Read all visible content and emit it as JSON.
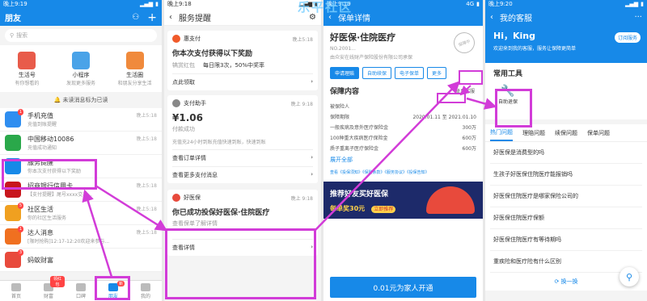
{
  "watermark": "乐平社区",
  "p1": {
    "status": {
      "time": "晚上9:19"
    },
    "title": "朋友",
    "search_placeholder": "搜索",
    "tiles": [
      {
        "name": "生活号",
        "sub": "有你想看的",
        "color": "#e85b4a"
      },
      {
        "name": "小程序",
        "sub": "发现更多服务",
        "color": "#4aa3e8"
      },
      {
        "name": "生活圈",
        "sub": "和朋友分享生活",
        "color": "#f08a3c"
      }
    ],
    "unread_bar": "未读消息标为已读",
    "messages": [
      {
        "title": "手机充值",
        "sub": "充值到账提醒",
        "time": "晚上5:18",
        "color": "#2f8ef0",
        "badge": "1"
      },
      {
        "title": "中国移动10086",
        "sub": "充值成功通知",
        "time": "晚上5:18",
        "color": "#2aa84a",
        "badge": ""
      },
      {
        "title": "服务提醒",
        "sub": "你本次支付获得以下奖励",
        "time": "",
        "color": "#1789e8",
        "badge": ""
      },
      {
        "title": "招商银行信用卡",
        "sub": "【支付提醒】尾号xxxx交易...",
        "time": "晚上5:18",
        "color": "#c8161d",
        "badge": ""
      },
      {
        "title": "社区生活",
        "sub": "你的社区生活服务",
        "time": "晚上5:18",
        "color": "#f0a020",
        "badge": "5"
      },
      {
        "title": "达人消息",
        "sub": "[限时抢购]12:17-12:20欢迎来参与...",
        "time": "晚上5:18",
        "color": "#f07020",
        "badge": "1"
      },
      {
        "title": "蚂蚁财富",
        "sub": "",
        "time": "",
        "color": "#e84a3c",
        "badge": "3"
      }
    ],
    "tabbar": [
      "首页",
      "财富",
      "口碑",
      "朋友",
      "我的"
    ],
    "tab_badge": "新",
    "tab_badge2": "领红包"
  },
  "p2": {
    "status": {
      "time": "晚上9:18"
    },
    "title": "服务提醒",
    "card1": {
      "app": "惠支付",
      "time": "晚上5:18",
      "title": "你本次支付获得以下奖励",
      "l1": "犒赏红包",
      "l2": "每日限3次，50%中奖率",
      "action": "点此领取"
    },
    "card2": {
      "app": "支付助手",
      "time": "晚上 9:18",
      "amount": "¥1.06",
      "status": "付款成功",
      "detail": "充值充24小时到账充值快速到账，快速到账",
      "a1": "查看订单详情",
      "a2": "查看更多支付消息"
    },
    "card3": {
      "app": "好医保",
      "time": "晚上 9:18",
      "title": "你已成功投保好医保·住院医疗",
      "sub": "查看保单了解详情",
      "action": "查看详情"
    }
  },
  "p3": {
    "status": {
      "time": "晚上9:19",
      "signal": "4G"
    },
    "title": "保单详情",
    "product": "好医保·住院医疗",
    "policy_no": "NO.2001...",
    "insurer": "由众安在线财产保险股份有限公司承保",
    "stamp": "保障中",
    "buttons": [
      "申请理赔",
      "自助续保",
      "电子保单",
      "更多"
    ],
    "service_link": "联系客服",
    "section": "保障内容",
    "rows": [
      {
        "k": "被保险人",
        "v": ""
      },
      {
        "k": "保障期限",
        "v": "2020.01.11 至 2021.01.10"
      },
      {
        "k": "一般疾病及意外医疗保险金",
        "v": "300万"
      },
      {
        "k": "100种重大疾病医疗保险金",
        "v": "600万"
      },
      {
        "k": "质子重离子医疗保险金",
        "v": "600万"
      }
    ],
    "expand": "展开全部",
    "links": "查看《投保须知》《保险条款》《服务协议》《投保告知》",
    "banner_title": "推荐好友买好医保",
    "banner_sub": "每单奖30元",
    "banner_btn": "立即推荐",
    "footer_btn": "0.01元为家人开通"
  },
  "p4": {
    "status": {
      "time": "晚上9:20"
    },
    "title": "我的客服",
    "greet": "Hi，King",
    "greet_sub": "欢迎来到我的客服，服务让保障更简单",
    "subscribe": "订阅服务",
    "tools_title": "常用工具",
    "tool": "自助退保",
    "tabs": [
      "热门问题",
      "理赔问题",
      "续保问题",
      "保单问题"
    ],
    "questions": [
      "好医保是消费型的吗",
      "生孩子好医保住院医疗能报销吗",
      "好医保住院医疗是哪家保险公司的",
      "好医保住院医疗保额",
      "好医保住院医疗有等待期吗",
      "重疾险和医疗险有什么区别"
    ],
    "refresh": "换一换"
  }
}
